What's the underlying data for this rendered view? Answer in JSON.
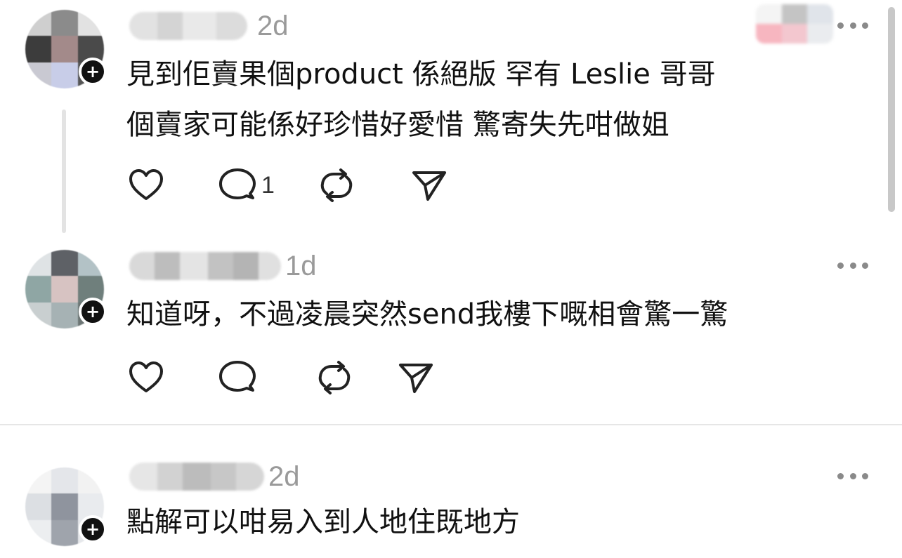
{
  "posts": [
    {
      "timestamp": "2d",
      "text": "見到佢賣果個product 係絕版 罕有 Leslie 哥哥\n個賣家可能係好珍惜好愛惜 驚寄失先咁做姐",
      "actions": {
        "reply_count": "1"
      }
    },
    {
      "timestamp": "1d",
      "text": "知道呀，不過凌晨突然send我樓下嘅相會驚一驚",
      "actions": {
        "reply_count": ""
      }
    },
    {
      "timestamp": "2d",
      "text": "點解可以咁易入到人地住既地方",
      "actions": {
        "reply_count": ""
      }
    }
  ],
  "icons": {
    "like": "heart-icon",
    "reply": "comment-bubble-icon",
    "repost": "repost-icon",
    "share": "paper-plane-icon",
    "more": "more-dots-icon"
  },
  "colors": {
    "text": "#111111",
    "meta": "#9a9a9a",
    "icon": "#222222",
    "divider": "#e6e6e6"
  }
}
